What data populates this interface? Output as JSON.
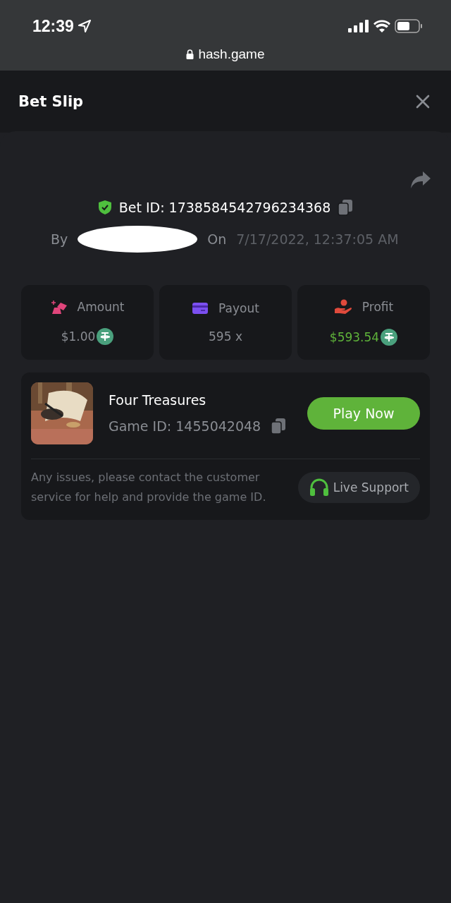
{
  "status_bar": {
    "time": "12:39"
  },
  "address_bar": {
    "url": "hash.game"
  },
  "header": {
    "title": "Bet Slip"
  },
  "bet": {
    "id_text": "Bet ID: 1738584542796234368",
    "verified": true,
    "by_label": "By",
    "on_label": "On",
    "date": "7/17/2022, 12:37:05 AM"
  },
  "stats": [
    {
      "kind": "amount",
      "label": "Amount",
      "value": "$1.00",
      "coin": true,
      "positive": false
    },
    {
      "kind": "payout",
      "label": "Payout",
      "value": "595 x",
      "coin": false,
      "positive": false
    },
    {
      "kind": "profit",
      "label": "Profit",
      "value": "$593.54",
      "coin": true,
      "positive": true
    }
  ],
  "game": {
    "name": "Four Treasures",
    "id_text": "Game ID: 1455042048",
    "play_button": "Play Now"
  },
  "support": {
    "message": "Any issues, please contact the customer service for help and provide the game ID.",
    "button": "Live Support"
  }
}
